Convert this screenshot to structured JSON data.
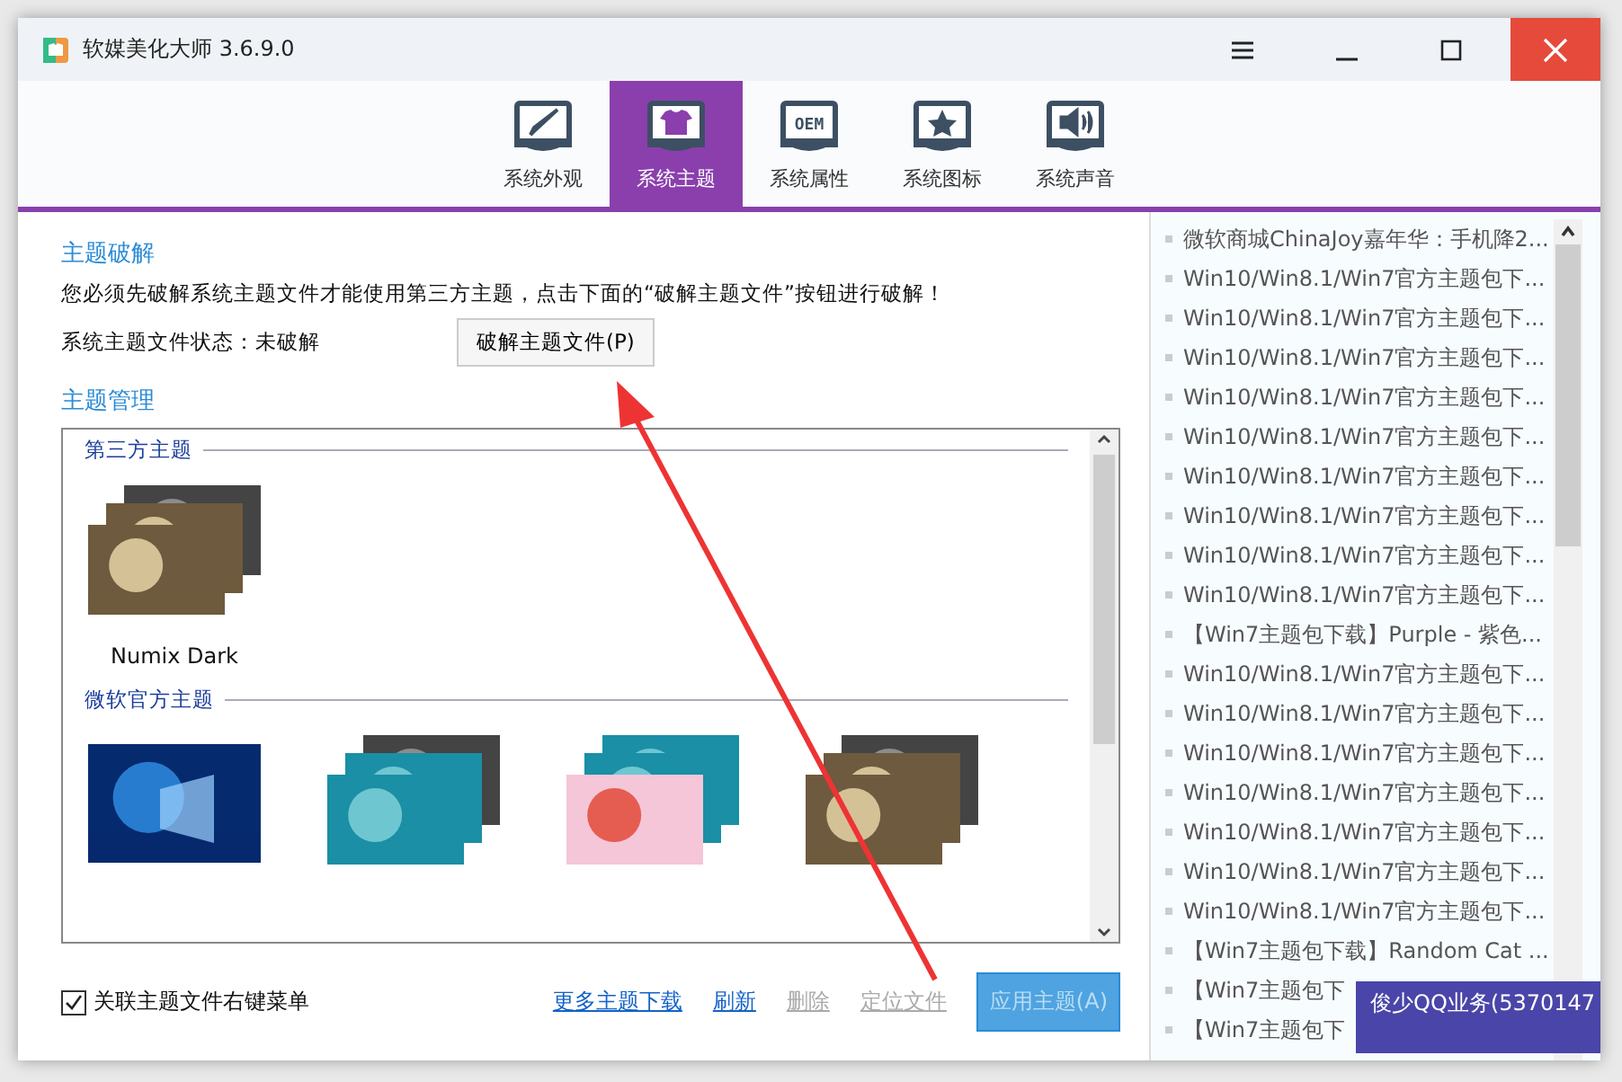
{
  "window": {
    "title": "软媒美化大师 3.6.9.0"
  },
  "tabs": [
    {
      "label": "系统外观",
      "kind": "brush",
      "selected": false
    },
    {
      "label": "系统主题",
      "kind": "shirt",
      "selected": true
    },
    {
      "label": "系统属性",
      "kind": "oem",
      "icon_text": "OEM",
      "selected": false
    },
    {
      "label": "系统图标",
      "kind": "star",
      "selected": false
    },
    {
      "label": "系统声音",
      "kind": "speaker",
      "selected": false
    }
  ],
  "crack": {
    "heading": "主题破解",
    "notice": "您必须先破解系统主题文件才能使用第三方主题，点击下面的“破解主题文件”按钮进行破解！",
    "status": "系统主题文件状态：未破解",
    "button": "破解主题文件(P)"
  },
  "manage": {
    "heading": "主题管理",
    "groups": [
      {
        "title": "第三方主题",
        "themes": [
          {
            "name": "Numix Dark",
            "kind": "picture"
          }
        ]
      },
      {
        "title": "微软官方主题"
      }
    ]
  },
  "footer": {
    "checkbox": {
      "label": "关联主题文件右键菜单",
      "checked": true
    },
    "links": [
      {
        "label": "更多主题下载",
        "disabled": false
      },
      {
        "label": "刷新",
        "disabled": false
      },
      {
        "label": "删除",
        "disabled": true
      },
      {
        "label": "定位文件",
        "disabled": true
      }
    ],
    "apply": {
      "label": "应用主题(A)",
      "disabled": true
    }
  },
  "news": [
    "微软商城ChinaJoy嘉年华：手机降2...",
    "Win10/Win8.1/Win7官方主题包下...",
    "Win10/Win8.1/Win7官方主题包下...",
    "Win10/Win8.1/Win7官方主题包下...",
    "Win10/Win8.1/Win7官方主题包下...",
    "Win10/Win8.1/Win7官方主题包下...",
    "Win10/Win8.1/Win7官方主题包下...",
    "Win10/Win8.1/Win7官方主题包下...",
    "Win10/Win8.1/Win7官方主题包下...",
    "Win10/Win8.1/Win7官方主题包下...",
    "【Win7主题包下载】Purple - 紫色...",
    "Win10/Win8.1/Win7官方主题包下...",
    "Win10/Win8.1/Win7官方主题包下...",
    "Win10/Win8.1/Win7官方主题包下...",
    "Win10/Win8.1/Win7官方主题包下...",
    "Win10/Win8.1/Win7官方主题包下...",
    "Win10/Win8.1/Win7官方主题包下...",
    "Win10/Win8.1/Win7官方主题包下...",
    "【Win7主题包下载】Random Cat ...",
    "【Win7主题包下",
    "【Win7主题包下"
  ],
  "taskbar_popup": {
    "title": "俊少QQ业务(5370147"
  }
}
